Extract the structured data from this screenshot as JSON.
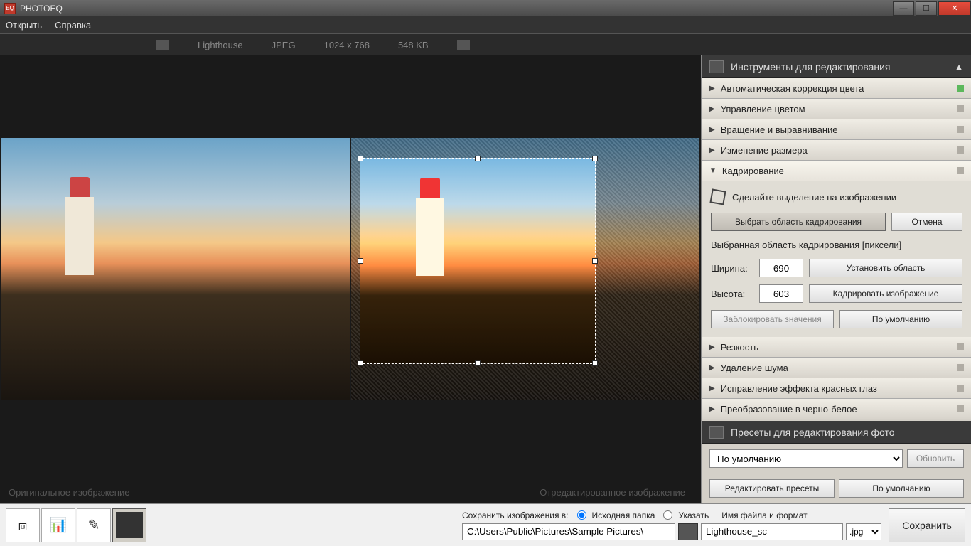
{
  "window": {
    "title": "PHOTOEQ"
  },
  "menu": {
    "open": "Открыть",
    "help": "Справка"
  },
  "info": {
    "name": "Lighthouse",
    "format": "JPEG",
    "dims": "1024 x 768",
    "size": "548 KB"
  },
  "labels": {
    "original": "Оригинальное изображение",
    "edited": "Отредактированное изображение"
  },
  "sidebar": {
    "tools_title": "Инструменты для редактирования",
    "items": [
      "Автоматическая коррекция цвета",
      "Управление цветом",
      "Вращение и выравнивание",
      "Изменение размера",
      "Кадрирование",
      "Резкость",
      "Удаление шума",
      "Исправление эффекта красных глаз",
      "Преобразование в черно-белое"
    ],
    "crop": {
      "hint": "Сделайте выделение на изображении",
      "select_btn": "Выбрать область кадрирования",
      "cancel_btn": "Отмена",
      "selected_label": "Выбранная область кадрирования [пиксели]",
      "width_label": "Ширина:",
      "width_val": "690",
      "height_label": "Высота:",
      "height_val": "603",
      "set_btn": "Установить область",
      "crop_btn": "Кадрировать изображение",
      "lock_btn": "Заблокировать значения",
      "default_btn": "По умолчанию"
    },
    "presets": {
      "title": "Пресеты для редактирования фото",
      "selected": "По умолчанию",
      "update": "Обновить",
      "edit": "Редактировать пресеты",
      "default": "По умолчанию"
    }
  },
  "bottom": {
    "save_to": "Сохранить изображения в:",
    "src_folder": "Исходная папка",
    "specify": "Указать",
    "name_fmt": "Имя файла и формат",
    "path": "C:\\Users\\Public\\Pictures\\Sample Pictures\\",
    "filename": "Lighthouse_sc",
    "ext": ".jpg",
    "save": "Сохранить"
  }
}
